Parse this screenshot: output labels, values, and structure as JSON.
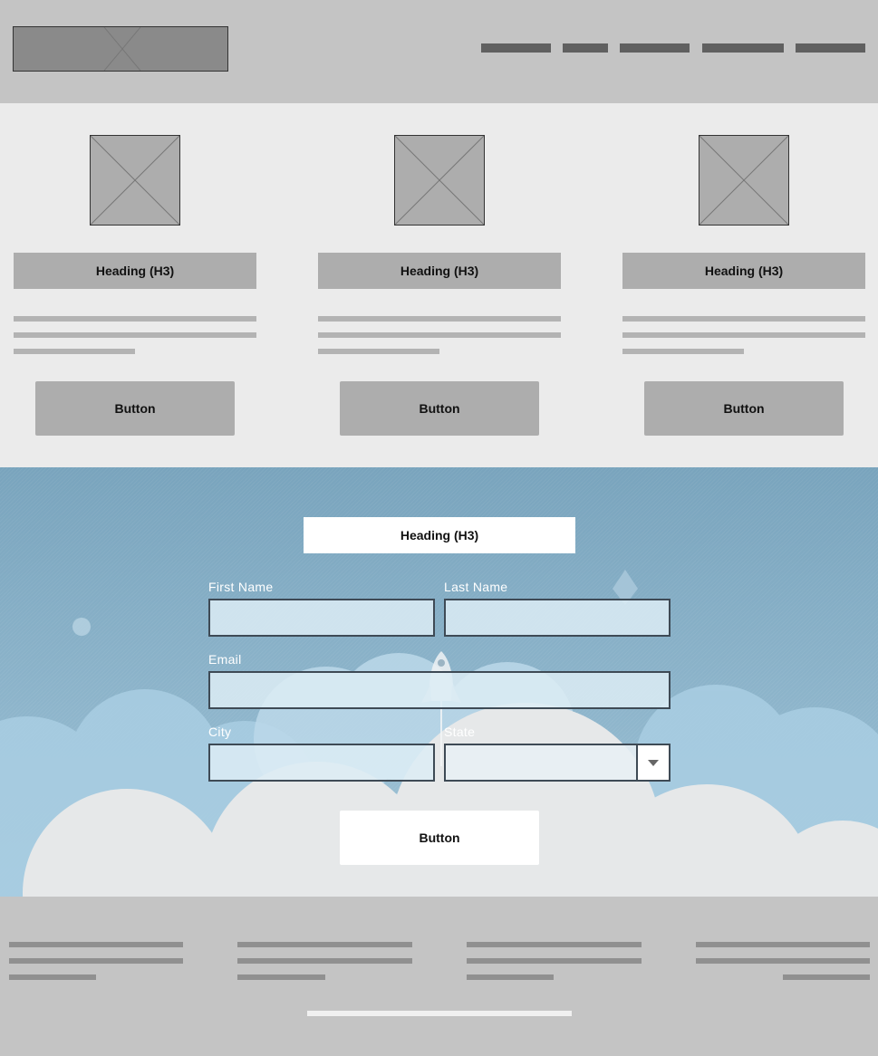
{
  "header": {
    "logo_icon": "image-placeholder-icon",
    "nav_item_count": 5
  },
  "features": {
    "cards": [
      {
        "image_icon": "image-placeholder-icon",
        "heading": "Heading (H3)",
        "button_label": "Button"
      },
      {
        "image_icon": "image-placeholder-icon",
        "heading": "Heading (H3)",
        "button_label": "Button"
      },
      {
        "image_icon": "image-placeholder-icon",
        "heading": "Heading (H3)",
        "button_label": "Button"
      }
    ]
  },
  "form": {
    "heading": "Heading (H3)",
    "first_name_label": "First Name",
    "last_name_label": "Last Name",
    "email_label": "Email",
    "city_label": "City",
    "state_label": "State",
    "first_name_value": "",
    "last_name_value": "",
    "email_value": "",
    "city_value": "",
    "state_value": "",
    "submit_label": "Button",
    "background_icons": [
      "rocket-icon",
      "cloud-icon",
      "diamond-icon",
      "planet-icon"
    ]
  },
  "colors": {
    "header_bg": "#c4c4c4",
    "features_bg": "#ebebeb",
    "placeholder_gray": "#adadad",
    "form_sky": "#8fb6cc",
    "input_border": "#3e4a55"
  }
}
